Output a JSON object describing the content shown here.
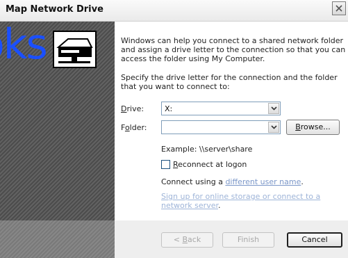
{
  "window": {
    "title": "Map Network Drive"
  },
  "overlay": {
    "text": "oks"
  },
  "intro": {
    "line1": "Windows can help you connect to a shared network folder",
    "line2": "and assign a drive letter to the connection so that you can",
    "line3": "access the folder using My Computer."
  },
  "specify": {
    "line1": "Specify the drive letter for the connection and the folder",
    "line2": "that you want to connect to:"
  },
  "drive": {
    "label_prefix": "",
    "label_underlined": "D",
    "label_rest": "rive:",
    "value": "X:"
  },
  "folder": {
    "label_prefix": "F",
    "label_underlined": "o",
    "label_rest": "lder:",
    "value": ""
  },
  "browse": {
    "label_underlined": "B",
    "label_rest": "rowse..."
  },
  "example": "Example: \\\\server\\share",
  "reconnect": {
    "label_underlined": "R",
    "label_rest": "econnect at logon",
    "checked": false
  },
  "connect_using": {
    "prefix": "Connect using a ",
    "link": "different user name",
    "suffix": "."
  },
  "signup": {
    "line1": "Sign up for online storage or connect to a",
    "line2": "network server",
    "suffix": "."
  },
  "buttons": {
    "back_prefix": "< ",
    "back_underlined": "B",
    "back_rest": "ack",
    "finish": "Finish",
    "cancel": "Cancel"
  }
}
